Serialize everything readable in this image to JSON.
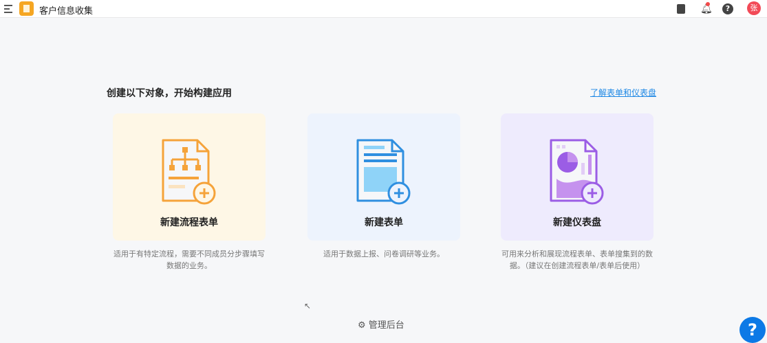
{
  "app": {
    "title": "客户信息收集",
    "avatar_text": "张"
  },
  "main": {
    "heading": "创建以下对象，开始构建应用",
    "learn_link": "了解表单和仪表盘",
    "cards": [
      {
        "title": "新建流程表单",
        "desc": "适用于有特定流程，需要不同成员分步骤填写数据的业务。",
        "color": "#f5a33a"
      },
      {
        "title": "新建表单",
        "desc": "适用于数据上报、问卷调研等业务。",
        "color": "#2f8fe0"
      },
      {
        "title": "新建仪表盘",
        "desc": "可用来分析和展现流程表单、表单搜集到的数据。（建议在创建流程表单/表单后使用）",
        "color": "#9b5de5"
      }
    ]
  },
  "footer": {
    "admin_label": "管理后台",
    "help_fab": "?"
  }
}
